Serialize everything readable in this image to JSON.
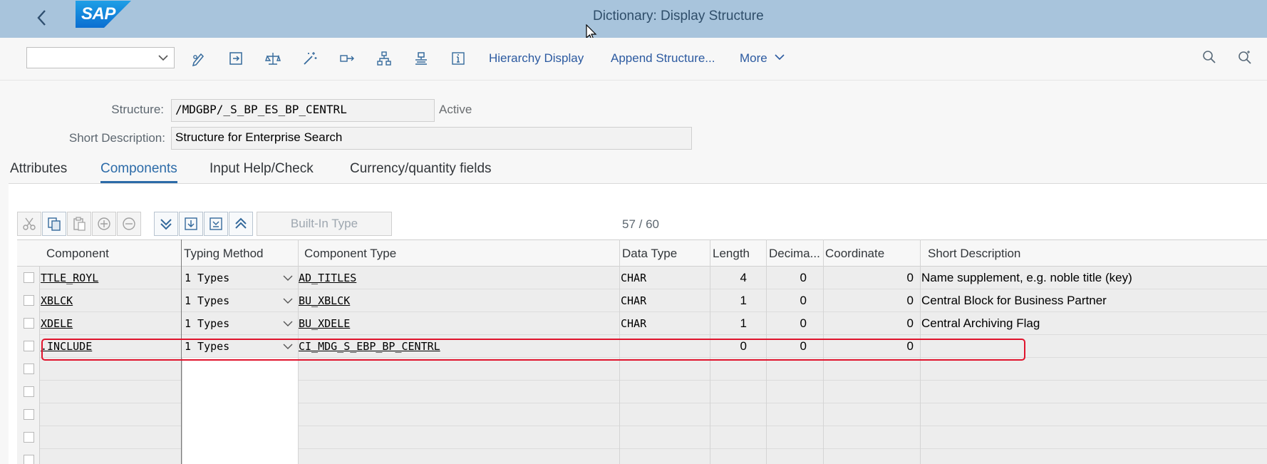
{
  "shell": {
    "title": "Dictionary: Display Structure",
    "logo_text": "SAP",
    "brand_color": "#0a6ed1",
    "header_color": "#a8c4dc"
  },
  "toolbar": {
    "combo_value": "",
    "icons": [
      "display-change-icon",
      "activate-icon",
      "check-icon",
      "magic-wand-icon",
      "where-used-icon",
      "object-list-icon",
      "navigator-icon",
      "info-icon"
    ],
    "hierarchy_display": "Hierarchy Display",
    "append_structure": "Append Structure...",
    "more": "More"
  },
  "form": {
    "structure_label": "Structure:",
    "structure_value": "/MDGBP/_S_BP_ES_BP_CENTRL",
    "status": "Active",
    "short_desc_label": "Short Description:",
    "short_desc_value": "Structure for Enterprise Search"
  },
  "tabs": [
    {
      "label": "Attributes",
      "active": false
    },
    {
      "label": "Components",
      "active": true
    },
    {
      "label": "Input Help/Check",
      "active": false
    },
    {
      "label": "Currency/quantity fields",
      "active": false
    }
  ],
  "table_toolbar": {
    "builtin_type": "Built-In Type",
    "row_count": "57  /  60"
  },
  "table": {
    "columns": [
      "Component",
      "Typing Method",
      "Component Type",
      "Data Type",
      "Length",
      "Decima...",
      "Coordinate",
      "Short Description"
    ],
    "rows": [
      {
        "component": "TTLE_ROYL",
        "typing": "1 Types",
        "comp_type": "AD_TITLES",
        "data_type": "CHAR",
        "length": "4",
        "decimals": "0",
        "coordinate": "0",
        "short_desc": "Name supplement, e.g. noble title (key)"
      },
      {
        "component": "XBLCK",
        "typing": "1 Types",
        "comp_type": "BU_XBLCK",
        "data_type": "CHAR",
        "length": "1",
        "decimals": "0",
        "coordinate": "0",
        "short_desc": "Central Block for Business Partner"
      },
      {
        "component": "XDELE",
        "typing": "1 Types",
        "comp_type": "BU_XDELE",
        "data_type": "CHAR",
        "length": "1",
        "decimals": "0",
        "coordinate": "0",
        "short_desc": "Central Archiving Flag"
      },
      {
        "component": ".INCLUDE",
        "typing": "1 Types",
        "comp_type": "CI_MDG_S_EBP_BP_CENTRL",
        "data_type": "",
        "length": "0",
        "decimals": "0",
        "coordinate": "0",
        "short_desc": ""
      }
    ],
    "highlight_color": "#e0142d"
  }
}
